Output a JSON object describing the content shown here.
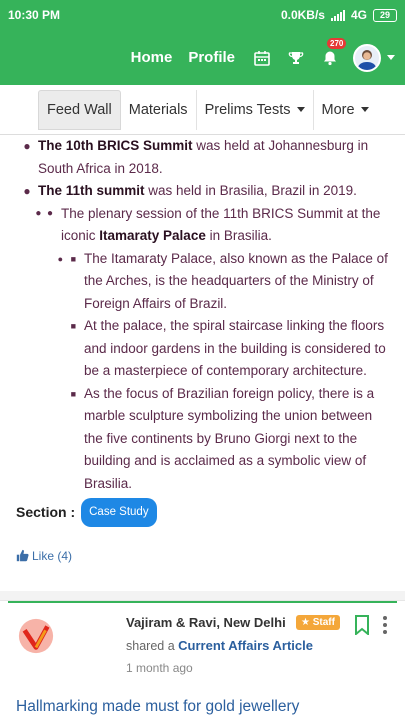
{
  "status_bar": {
    "time": "10:30 PM",
    "speed": "0.0KB/s",
    "network": "4G",
    "battery": "29"
  },
  "header": {
    "nav": [
      "Home",
      "Profile"
    ],
    "icons": [
      "calendar-icon",
      "trophy-icon",
      "bell-icon"
    ],
    "notification_count": "270"
  },
  "tabs": [
    {
      "label": "Feed Wall",
      "active": true
    },
    {
      "label": "Materials",
      "active": false
    },
    {
      "label": "Prelims Tests",
      "dropdown": true
    },
    {
      "label": "More",
      "dropdown": true
    }
  ],
  "post": {
    "items": [
      {
        "bold": "The 10th BRICS Summit",
        "rest": " was held at Johannesburg in South Africa in 2018."
      },
      {
        "bold": "The 11th summit",
        "rest": " was held in Brasilia, Brazil in 2019."
      },
      {
        "pre": "The plenary session of the 11th BRICS Summit at the iconic ",
        "bold": "Itamaraty Palace",
        "post": " in Brasilia."
      },
      "The Itamaraty Palace, also known as the Palace of the Arches, is the headquarters of the Ministry of Foreign Affairs of Brazil.",
      "At the palace, the spiral staircase linking the floors and indoor gardens in the building is considered to be a masterpiece of contemporary architecture.",
      "As the focus of Brazilian foreign policy, there is a marble sculpture symbolizing the union between the five continents by Bruno Giorgi next to the building and is acclaimed as a symbolic view of Brasilia."
    ],
    "section_label": "Section :",
    "section_tag": "Case Study",
    "like_label": "Like (4)"
  },
  "next_post": {
    "author": "Vajiram & Ravi, New Delhi",
    "badge": "Staff",
    "shared_prefix": "shared a",
    "shared_link": "Current Affairs Article",
    "time_ago": "1 month ago",
    "headline": "Hallmarking made must for gold jewellery"
  },
  "colors": {
    "brand_green": "#36b35a",
    "link_blue": "#2b5f9e",
    "pill_blue": "#1e88e5",
    "staff_orange": "#f4a73a"
  }
}
